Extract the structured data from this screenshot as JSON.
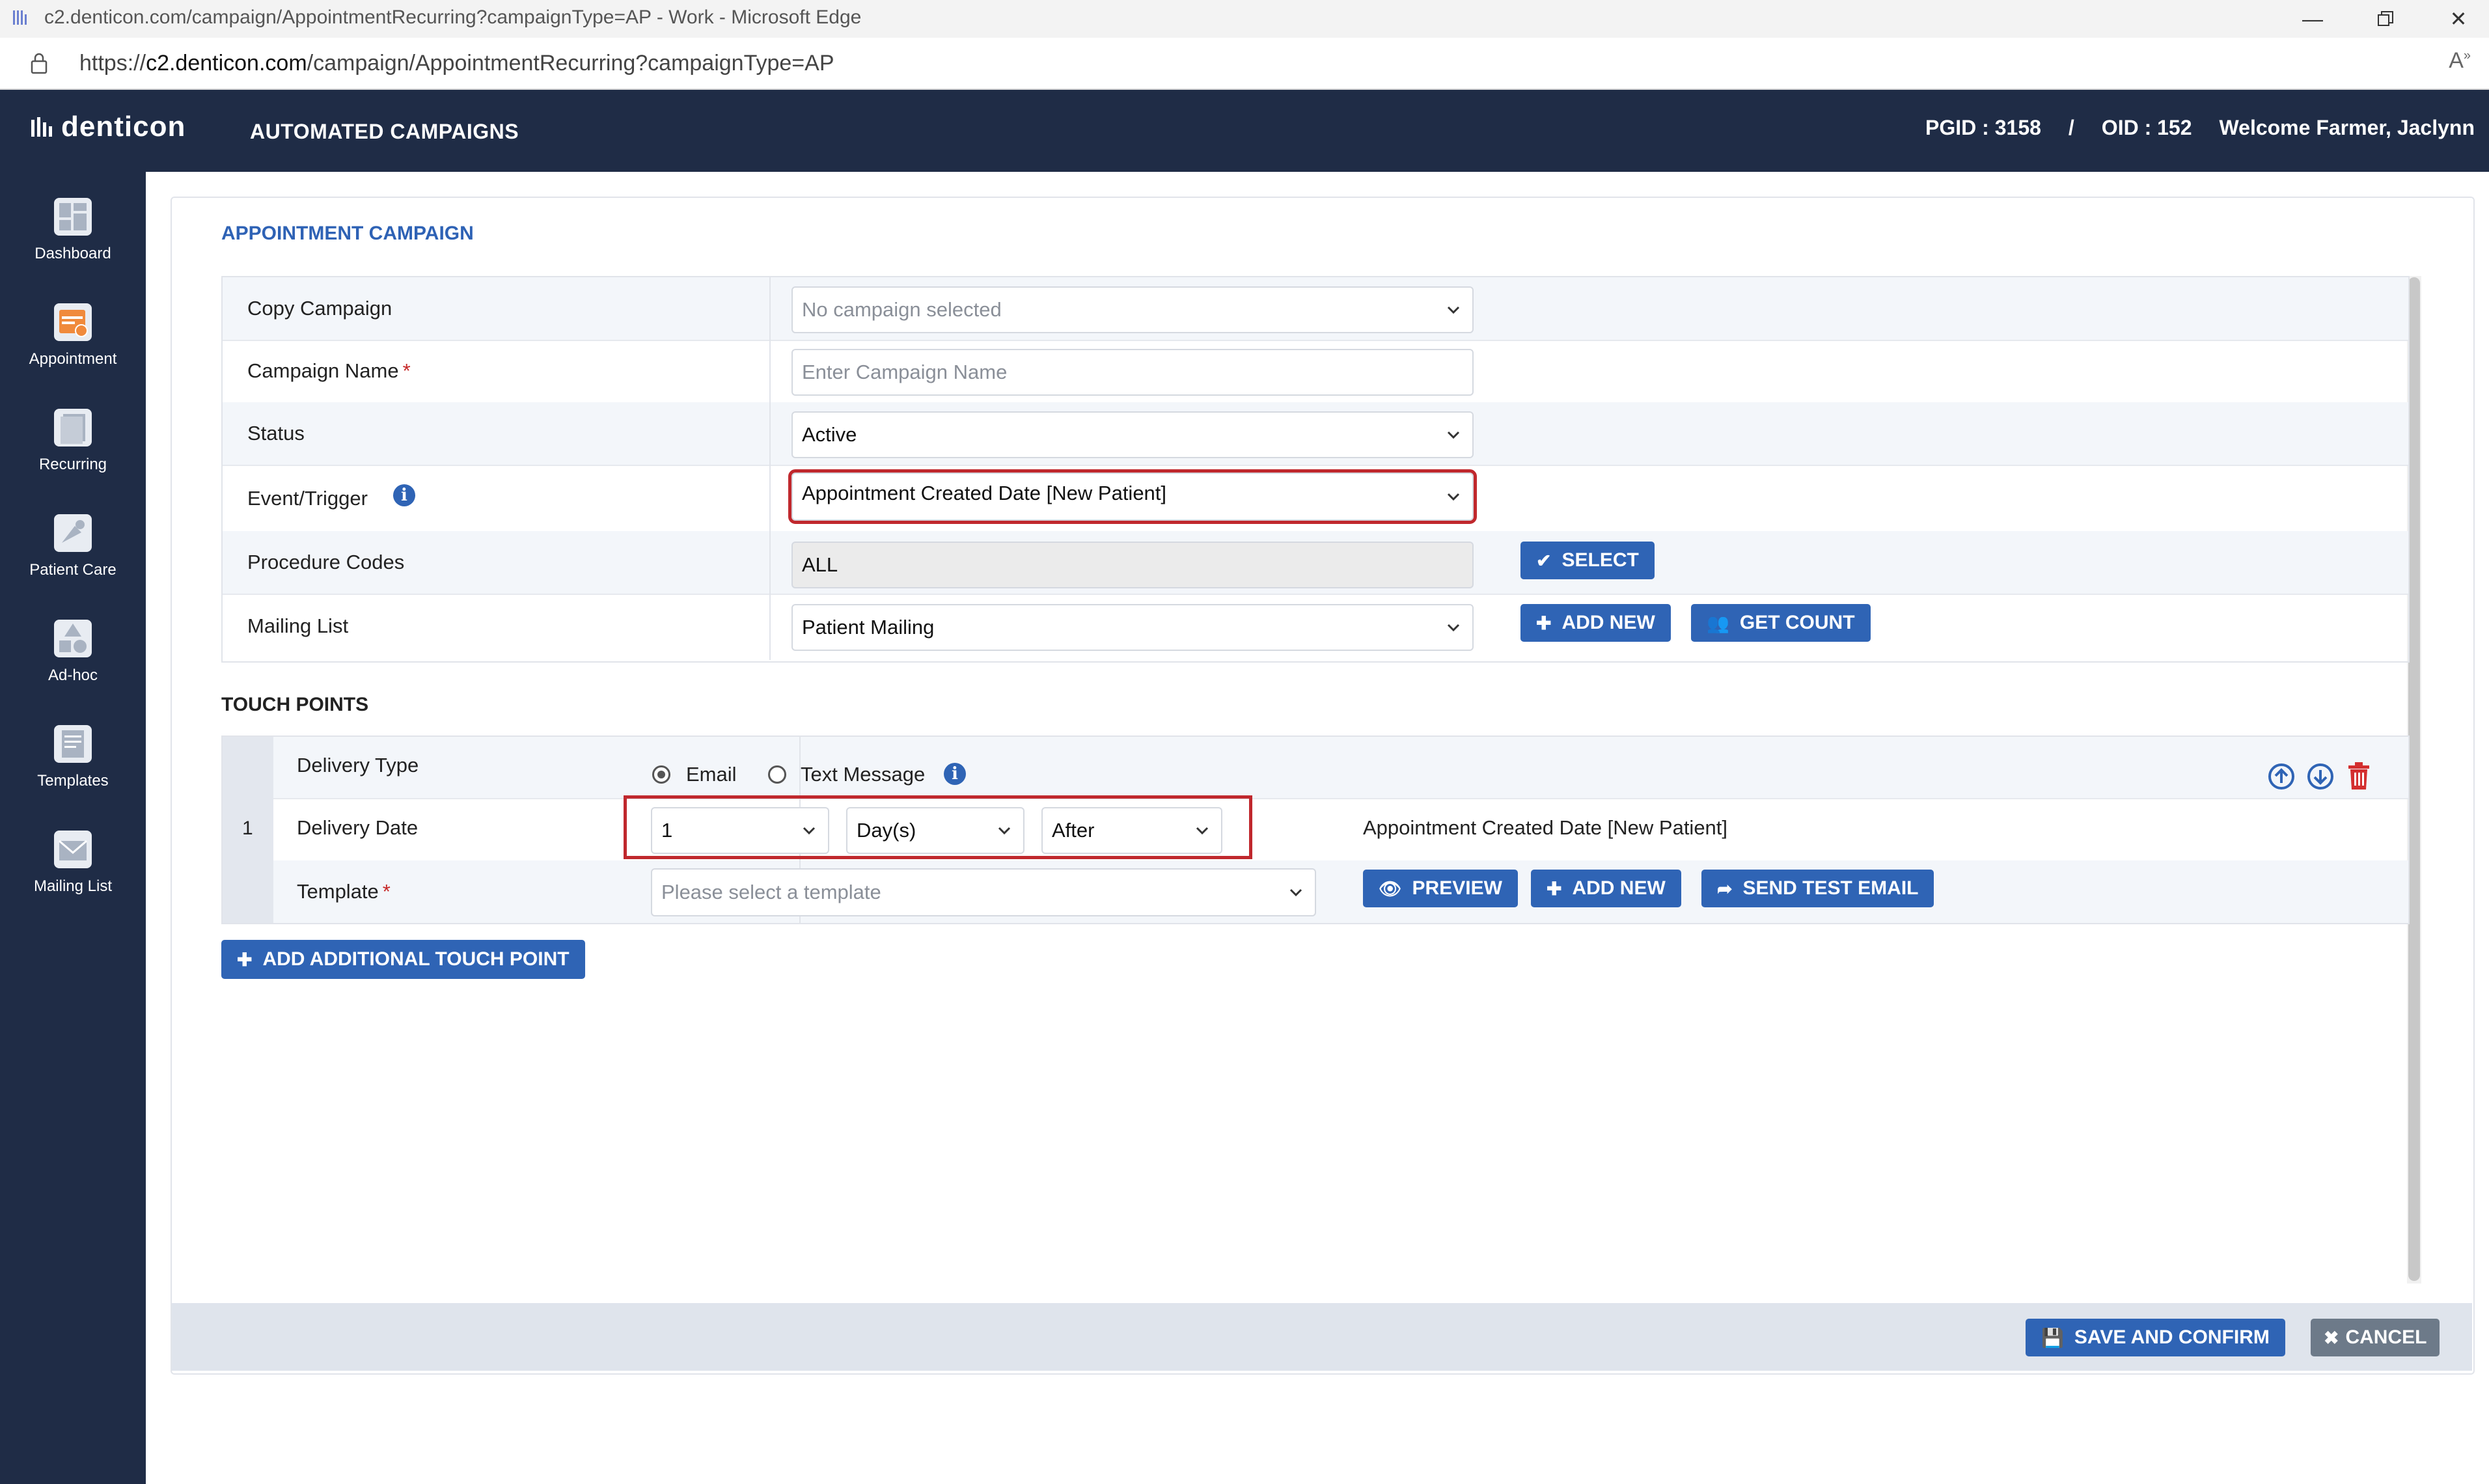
{
  "browser": {
    "window_title": "c2.denticon.com/campaign/AppointmentRecurring?campaignType=AP - Work - Microsoft Edge",
    "url_prefix": "https://",
    "url_host": "c2.denticon.com",
    "url_path": "/campaign/AppointmentRecurring?campaignType=AP"
  },
  "header": {
    "logo": "denticon",
    "title": "AUTOMATED CAMPAIGNS",
    "pgid": "PGID : 3158",
    "separator": "/",
    "oid": "OID : 152",
    "welcome": "Welcome Farmer, Jaclynn"
  },
  "sidebar": {
    "items": [
      {
        "label": "Dashboard",
        "icon": "dashboard-icon"
      },
      {
        "label": "Appointment",
        "icon": "appointment-icon"
      },
      {
        "label": "Recurring",
        "icon": "recurring-icon"
      },
      {
        "label": "Patient Care",
        "icon": "patient-care-icon"
      },
      {
        "label": "Ad-hoc",
        "icon": "ad-hoc-icon"
      },
      {
        "label": "Templates",
        "icon": "templates-icon"
      },
      {
        "label": "Mailing List",
        "icon": "mailing-list-icon"
      }
    ]
  },
  "form": {
    "section_title": "APPOINTMENT CAMPAIGN",
    "copy_campaign": {
      "label": "Copy Campaign",
      "placeholder": "No campaign selected"
    },
    "campaign_name": {
      "label": "Campaign Name",
      "required": "*",
      "placeholder": "Enter Campaign Name"
    },
    "status": {
      "label": "Status",
      "value": "Active"
    },
    "event_trigger": {
      "label": "Event/Trigger",
      "value": "Appointment Created Date [New Patient]"
    },
    "procedure_codes": {
      "label": "Procedure Codes",
      "value": "ALL",
      "button": "SELECT"
    },
    "mailing_list": {
      "label": "Mailing List",
      "value": "Patient Mailing",
      "add_new": "ADD NEW",
      "get_count": "GET COUNT"
    }
  },
  "touch_points": {
    "section_title": "TOUCH POINTS",
    "items": [
      {
        "number": "1",
        "delivery_type_label": "Delivery Type",
        "email_label": "Email",
        "text_label": "Text Message",
        "selected": "Email",
        "delivery_date_label": "Delivery Date",
        "amount": "1",
        "unit": "Day(s)",
        "relation": "After",
        "trigger_text": "Appointment Created Date [New Patient]",
        "template_label": "Template",
        "template_required": "*",
        "template_placeholder": "Please select a template",
        "preview": "PREVIEW",
        "add_new": "ADD NEW",
        "send_test": "SEND TEST EMAIL"
      }
    ],
    "add_button": "ADD ADDITIONAL TOUCH POINT"
  },
  "footer": {
    "save": "SAVE AND CONFIRM",
    "cancel": "CANCEL"
  },
  "colors": {
    "nav_bg": "#1f2c46",
    "primary": "#2f64b5",
    "highlight": "#c0282d",
    "danger": "#d32f2f"
  }
}
